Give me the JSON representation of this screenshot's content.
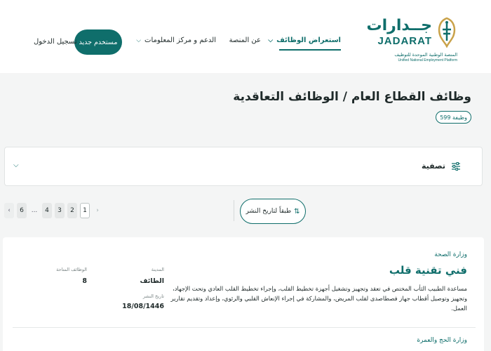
{
  "header": {
    "logo": {
      "ar_name": "جــدارات",
      "en_name": "JADARAT",
      "sub_ar": "المنصة الوطنية الموحدة للتوظيف",
      "sub_en": "Unified National Employment Platform"
    },
    "nav": {
      "jobs": "استعراض الوظائف",
      "about": "عن المنصة",
      "support": "الدعم و مركز المعلومات"
    },
    "register_label": "مستخدم جديد",
    "login_label": "تسجيل الدخول"
  },
  "page": {
    "title": "وظائف القطاع العام / الوظائف التعاقدية",
    "count_badge": "599 وظيفة"
  },
  "filter": {
    "label": "تصفية"
  },
  "sort": {
    "label": "طبقاً لتاريخ النشر"
  },
  "pagination": {
    "pages": [
      "1",
      "2",
      "3",
      "4",
      "...",
      "6"
    ],
    "active": "1"
  },
  "jobs": [
    {
      "ministry": "وزارة الصحة",
      "title": "فني تقنية قلب",
      "description": "مساعدة الطبيب الثأب المختص في تعقد وتجهيز وتشغيل أجهزة تخطيط القلب، وإجراء تخطيط القلب العادي وتحت الإجهاد، وتجهيز وتوصيل أقطاب جهاز فصطاصدى لقلب المريض، والمشاركة في إجراء الإنعاش القلبي والرئوي، وإعداد وتقديم تقارير العمل.",
      "city_label": "المدينة",
      "city": "الطائف",
      "vacancies_label": "الوظائف المتاحة",
      "vacancies": "8",
      "date_label": "تاريخ النشر",
      "date": "18/08/1446"
    },
    {
      "ministry": "وزارة الحج والعمرة"
    }
  ],
  "colors": {
    "brand": "#0f6e6b",
    "background": "#f4f5f5"
  }
}
